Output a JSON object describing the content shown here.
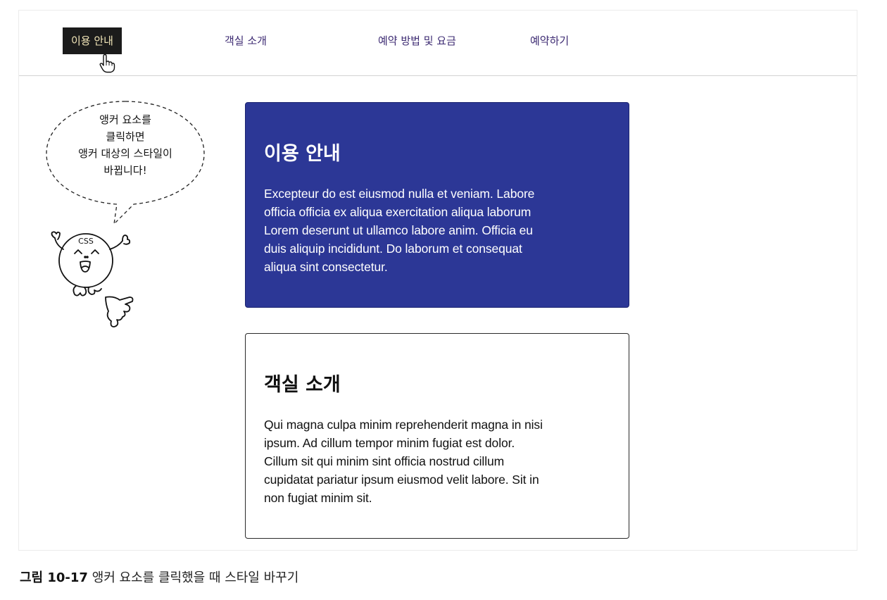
{
  "nav": {
    "items": [
      {
        "label": "이용 안내",
        "active": true
      },
      {
        "label": "객실 소개",
        "active": false
      },
      {
        "label": "예약 방법 및 요금",
        "active": false
      },
      {
        "label": "예약하기",
        "active": false
      }
    ]
  },
  "bubble": {
    "lines": [
      "앵커 요소를",
      "클릭하면",
      "앵커 대상의 스타일이",
      "바뀝니다!"
    ]
  },
  "mascot": {
    "badge": "CSS"
  },
  "cards": [
    {
      "title": "이용 안내",
      "lines": [
        "Excepteur do est eiusmod nulla et veniam. Labore",
        "officia officia ex aliqua exercitation aliqua laborum",
        "Lorem deserunt ut ullamco labore anim. Officia eu",
        "duis aliquip incididunt. Do laborum et consequat",
        "aliqua sint consectetur."
      ]
    },
    {
      "title": "객실 소개",
      "lines": [
        "Qui magna culpa minim reprehenderit magna in nisi",
        "ipsum. Ad cillum tempor minim fugiat est dolor.",
        "Cillum sit qui minim sint officia nostrud cillum",
        "cupidatat pariatur ipsum eiusmod velit labore. Sit in",
        "non fugiat minim sit."
      ]
    }
  ],
  "caption": {
    "label": "그림 10-17",
    "text": "앵커 요소를 클릭했을 때 스타일 바꾸기"
  },
  "colors": {
    "active_nav_bg": "#1b1b1b",
    "active_nav_text": "#f2e6b8",
    "nav_text": "#3c2a72",
    "target_card_bg": "#2c3796"
  },
  "icons": {
    "cursor": "pointer-hand-icon"
  }
}
